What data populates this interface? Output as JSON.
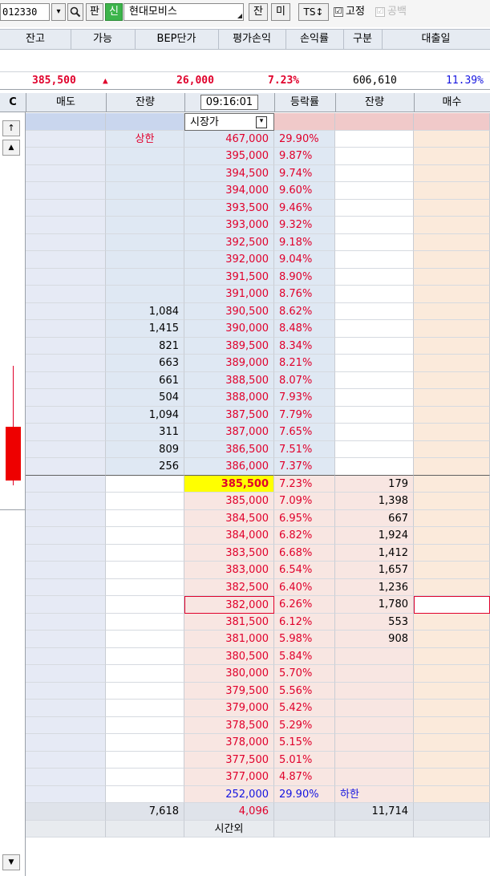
{
  "toolbar": {
    "code": "012330",
    "code_drop_icon": "▾",
    "search_icon": "search-icon",
    "pan_label": "판",
    "shin_label": "신",
    "stock_name": "현대모비스",
    "jan_label": "잔",
    "mi_label": "미",
    "ts_label": "TS↕",
    "fixed_check": "☑",
    "fixed_label": "고정",
    "blank_check": "☑",
    "blank_label": "공백"
  },
  "balance_header": {
    "columns": [
      "잔고",
      "가능",
      "BEP단가",
      "평가손익",
      "손익률",
      "구분",
      "대출일"
    ]
  },
  "summary": {
    "price": "385,500",
    "arrow": "▲",
    "change": "26,000",
    "rate": "7.23%",
    "volume": "606,610",
    "turnover": "11.39%"
  },
  "orderbook_header": {
    "c_label": "C",
    "sell": "매도",
    "sell_qty": "잔량",
    "time": "09:16:01",
    "change_rate": "등락률",
    "buy_qty": "잔량",
    "buy": "매수"
  },
  "strip": {
    "up_icon": "↑",
    "scroll_up_icon": "▲",
    "scroll_down_icon": "▼"
  },
  "colors": {
    "up": "#e0002b",
    "down": "#1515e0",
    "current_highlight": "#ffff00",
    "ask_bg": "#dfe8f3",
    "bid_bg": "#f8e6e2",
    "buy_bg": "#fbeadb",
    "sell_bg": "#e6eaf5"
  },
  "open_row": {
    "label": "시장가",
    "drop_icon": "▾"
  },
  "upper_limit": {
    "tag": "상한",
    "price": "467,000",
    "rate": "29.90%"
  },
  "asks": [
    {
      "qty": "",
      "price": "395,000",
      "rate": "9.87%"
    },
    {
      "qty": "",
      "price": "394,500",
      "rate": "9.74%"
    },
    {
      "qty": "",
      "price": "394,000",
      "rate": "9.60%"
    },
    {
      "qty": "",
      "price": "393,500",
      "rate": "9.46%"
    },
    {
      "qty": "",
      "price": "393,000",
      "rate": "9.32%"
    },
    {
      "qty": "",
      "price": "392,500",
      "rate": "9.18%"
    },
    {
      "qty": "",
      "price": "392,000",
      "rate": "9.04%"
    },
    {
      "qty": "",
      "price": "391,500",
      "rate": "8.90%"
    },
    {
      "qty": "",
      "price": "391,000",
      "rate": "8.76%"
    },
    {
      "qty": "1,084",
      "price": "390,500",
      "rate": "8.62%"
    },
    {
      "qty": "1,415",
      "price": "390,000",
      "rate": "8.48%"
    },
    {
      "qty": "821",
      "price": "389,500",
      "rate": "8.34%"
    },
    {
      "qty": "663",
      "price": "389,000",
      "rate": "8.21%"
    },
    {
      "qty": "661",
      "price": "388,500",
      "rate": "8.07%"
    },
    {
      "qty": "504",
      "price": "388,000",
      "rate": "7.93%"
    },
    {
      "qty": "1,094",
      "price": "387,500",
      "rate": "7.79%"
    },
    {
      "qty": "311",
      "price": "387,000",
      "rate": "7.65%"
    },
    {
      "qty": "809",
      "price": "386,500",
      "rate": "7.51%"
    },
    {
      "qty": "256",
      "price": "386,000",
      "rate": "7.37%"
    }
  ],
  "bids": [
    {
      "price": "385,500",
      "rate": "7.23%",
      "qty": "179",
      "current": true
    },
    {
      "price": "385,000",
      "rate": "7.09%",
      "qty": "1,398"
    },
    {
      "price": "384,500",
      "rate": "6.95%",
      "qty": "667"
    },
    {
      "price": "384,000",
      "rate": "6.82%",
      "qty": "1,924"
    },
    {
      "price": "383,500",
      "rate": "6.68%",
      "qty": "1,412"
    },
    {
      "price": "383,000",
      "rate": "6.54%",
      "qty": "1,657"
    },
    {
      "price": "382,500",
      "rate": "6.40%",
      "qty": "1,236"
    },
    {
      "price": "382,000",
      "rate": "6.26%",
      "qty": "1,780",
      "boxed": true
    },
    {
      "price": "381,500",
      "rate": "6.12%",
      "qty": "553"
    },
    {
      "price": "381,000",
      "rate": "5.98%",
      "qty": "908"
    },
    {
      "price": "380,500",
      "rate": "5.84%",
      "qty": ""
    },
    {
      "price": "380,000",
      "rate": "5.70%",
      "qty": ""
    },
    {
      "price": "379,500",
      "rate": "5.56%",
      "qty": ""
    },
    {
      "price": "379,000",
      "rate": "5.42%",
      "qty": ""
    },
    {
      "price": "378,500",
      "rate": "5.29%",
      "qty": ""
    },
    {
      "price": "378,000",
      "rate": "5.15%",
      "qty": ""
    },
    {
      "price": "377,500",
      "rate": "5.01%",
      "qty": ""
    },
    {
      "price": "377,000",
      "rate": "4.87%",
      "qty": ""
    }
  ],
  "lower_limit": {
    "price": "252,000",
    "rate": "29.90%",
    "tag": "하한"
  },
  "totals": {
    "sell_qty": "7,618",
    "diff": "4,096",
    "buy_qty": "11,714"
  },
  "after_hours": {
    "label": "시간외"
  }
}
